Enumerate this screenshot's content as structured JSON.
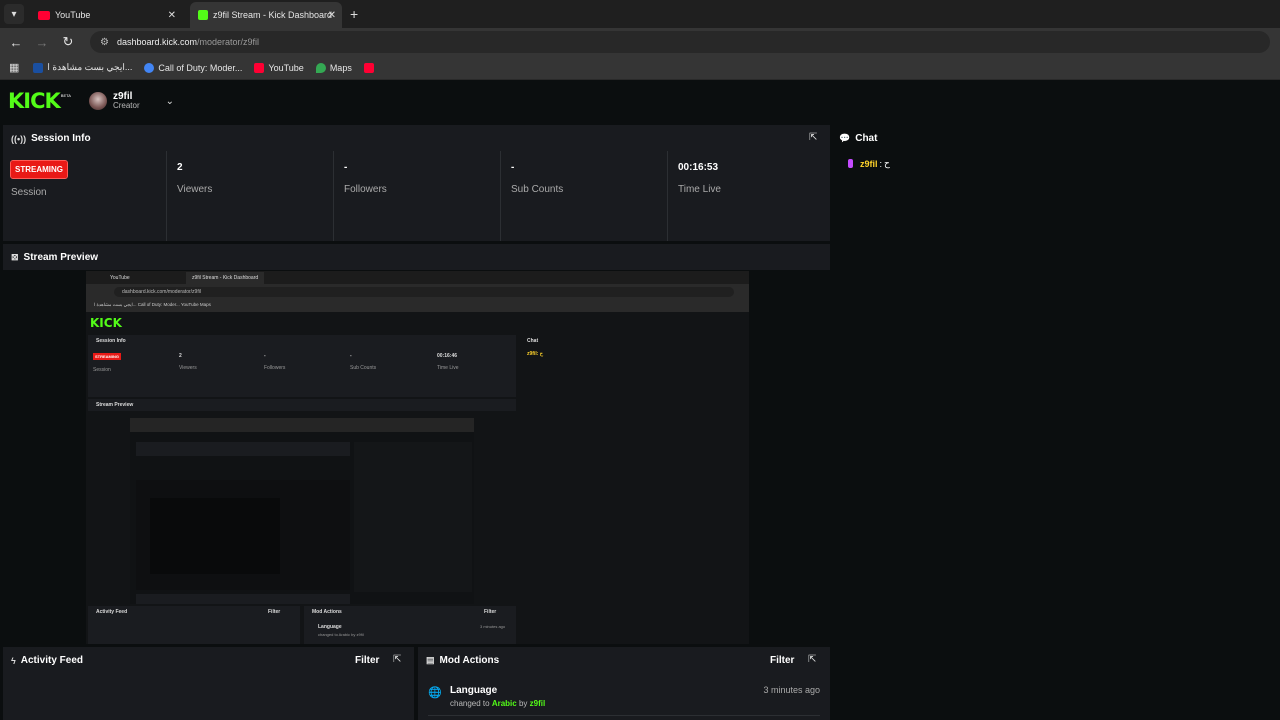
{
  "browser": {
    "tabs": [
      {
        "title": "YouTube",
        "active": false
      },
      {
        "title": "z9fil Stream - Kick Dashboard",
        "active": true
      }
    ],
    "new_tab_label": "+",
    "url_host": "dashboard.kick.com",
    "url_path": "/moderator/z9fil",
    "bookmarks": [
      {
        "label": "ايجي بست مشاهدة ا...",
        "icon": "site-icon",
        "color": "#1a4fa0"
      },
      {
        "label": "Call of Duty: Moder...",
        "icon": "google-icon",
        "color": "#4285f4"
      },
      {
        "label": "YouTube",
        "icon": "youtube-icon",
        "color": "#ff0033"
      },
      {
        "label": "Maps",
        "icon": "maps-icon",
        "color": "#34a853"
      },
      {
        "label": "",
        "icon": "youtube-icon",
        "color": "#ff0033"
      }
    ]
  },
  "header": {
    "logo": "KICK",
    "logo_tag": "BETA",
    "username": "z9fil",
    "role": "Creator"
  },
  "session": {
    "title": "Session Info",
    "status_badge": "STREAMING",
    "status_label": "Session",
    "stats": [
      {
        "value": "2",
        "label": "Viewers"
      },
      {
        "value": "-",
        "label": "Followers"
      },
      {
        "value": "-",
        "label": "Sub Counts"
      },
      {
        "value": "00:16:53",
        "label": "Time Live"
      }
    ]
  },
  "chat": {
    "title": "Chat",
    "messages": [
      {
        "user": "z9fil",
        "separator": ":",
        "text": "ح"
      }
    ]
  },
  "preview": {
    "title": "Stream Preview",
    "nested": {
      "tab1": "YouTube",
      "tab2": "z9fil Stream - Kick Dashboard",
      "url": "dashboard.kick.com/moderator/z9fil",
      "bookmarks": "ايجي بست مشاهدة ا...  Call of Duty: Moder...  YouTube  Maps",
      "session_title": "Session Info",
      "badge": "STREAMING",
      "session_label": "Session",
      "stats": [
        {
          "value": "2",
          "label": "Viewers"
        },
        {
          "value": "-",
          "label": "Followers"
        },
        {
          "value": "-",
          "label": "Sub Counts"
        },
        {
          "value": "00:16:46",
          "label": "Time Live"
        }
      ],
      "chat_title": "Chat",
      "chat_msg": "z9fil: ح",
      "preview_title": "Stream Preview",
      "activity_title": "Activity Feed",
      "mod_title": "Mod Actions",
      "filter": "Filter",
      "mod_item": "Language",
      "mod_detail": "changed to Arabic by z9fil",
      "mod_time": "3 minutes ago"
    }
  },
  "activity": {
    "title": "Activity Feed",
    "filter_label": "Filter"
  },
  "mod_actions": {
    "title": "Mod Actions",
    "filter_label": "Filter",
    "items": [
      {
        "title": "Language",
        "prefix": "changed to",
        "value": "Arabic",
        "by": "by",
        "user": "z9fil",
        "time": "3 minutes ago"
      }
    ]
  }
}
